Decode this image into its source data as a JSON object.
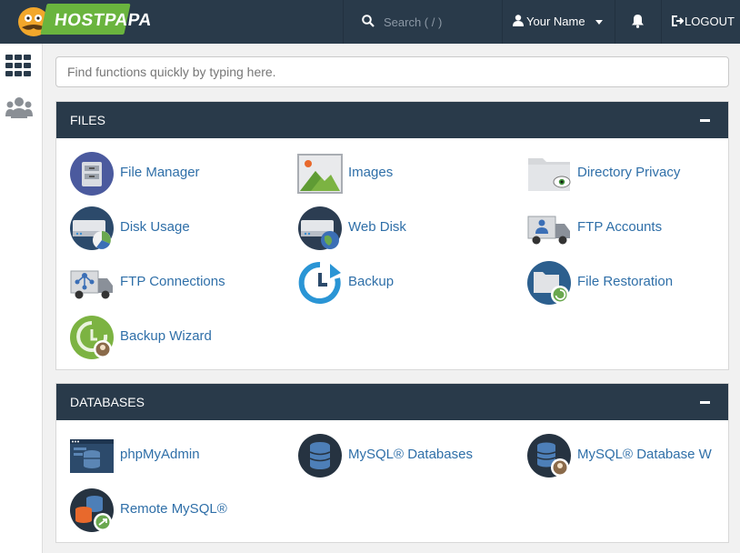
{
  "header": {
    "brand": "HOSTPAPA",
    "search_placeholder": "Search ( / )",
    "user_name": "Your Name",
    "logout_label": "LOGOUT"
  },
  "quick_find": {
    "placeholder": "Find functions quickly by typing here."
  },
  "sections": {
    "files": {
      "title": "FILES",
      "items": [
        {
          "label": "File Manager",
          "icon": "file-manager-icon"
        },
        {
          "label": "Images",
          "icon": "images-icon"
        },
        {
          "label": "Directory Privacy",
          "icon": "directory-privacy-icon"
        },
        {
          "label": "Disk Usage",
          "icon": "disk-usage-icon"
        },
        {
          "label": "Web Disk",
          "icon": "web-disk-icon"
        },
        {
          "label": "FTP Accounts",
          "icon": "ftp-accounts-icon"
        },
        {
          "label": "FTP Connections",
          "icon": "ftp-connections-icon"
        },
        {
          "label": "Backup",
          "icon": "backup-icon"
        },
        {
          "label": "File Restoration",
          "icon": "file-restoration-icon"
        },
        {
          "label": "Backup Wizard",
          "icon": "backup-wizard-icon"
        }
      ]
    },
    "databases": {
      "title": "DATABASES",
      "items": [
        {
          "label": "phpMyAdmin",
          "icon": "phpmyadmin-icon"
        },
        {
          "label": "MySQL® Databases",
          "icon": "mysql-databases-icon"
        },
        {
          "label": "MySQL® Database W",
          "icon": "mysql-database-wizard-icon"
        },
        {
          "label": "Remote MySQL®",
          "icon": "remote-mysql-icon"
        }
      ]
    }
  },
  "colors": {
    "topbar": "#293a4a",
    "link": "#2f6fa8",
    "brand_green": "#6ab43e"
  }
}
